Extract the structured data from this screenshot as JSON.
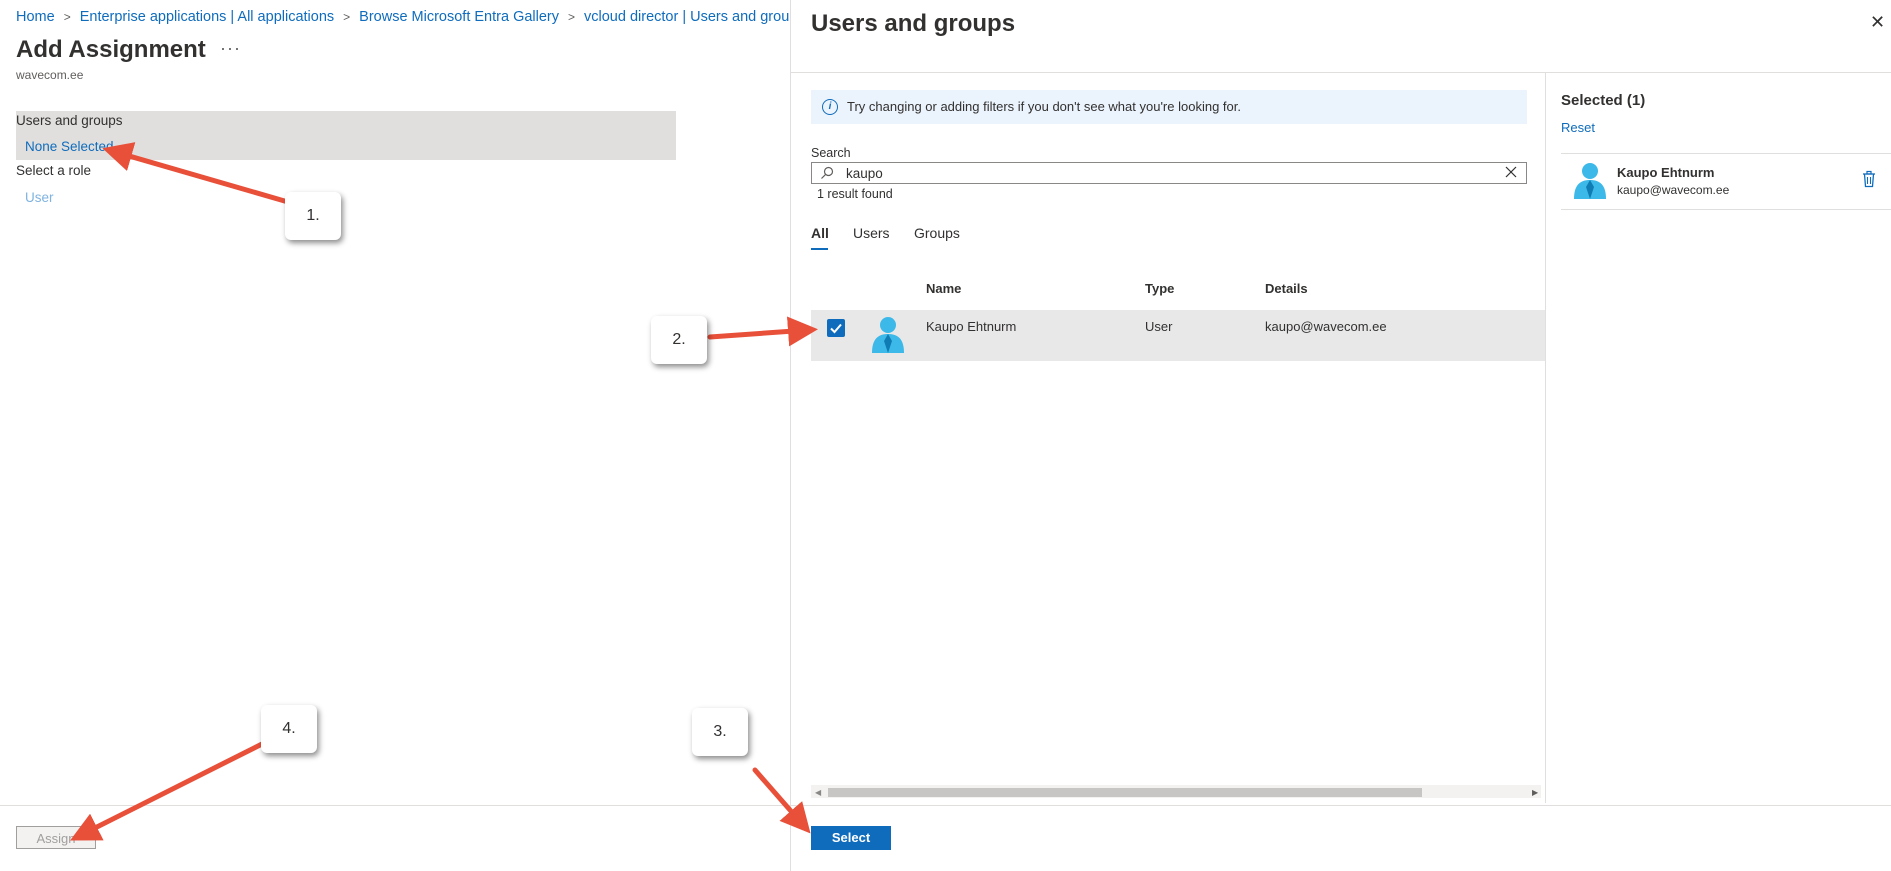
{
  "breadcrumb": [
    {
      "label": "Home"
    },
    {
      "label": "Enterprise applications | All applications"
    },
    {
      "label": "Browse Microsoft Entra Gallery"
    },
    {
      "label": "vcloud director | Users and groups"
    }
  ],
  "left": {
    "title": "Add Assignment",
    "more": "···",
    "subtitle": "wavecom.ee",
    "users_groups_label": "Users and groups",
    "users_groups_value": "None Selected",
    "role_label": "Select a role",
    "role_value": "User",
    "assign_button": "Assign"
  },
  "panel": {
    "title": "Users and groups",
    "close": "✕",
    "info_text": "Try changing or adding filters if you don't see what you're looking for.",
    "search_label": "Search",
    "search_value": "kaupo",
    "result_count": "1 result found",
    "tabs": [
      {
        "label": "All",
        "active": true
      },
      {
        "label": "Users",
        "active": false
      },
      {
        "label": "Groups",
        "active": false
      }
    ],
    "columns": [
      "Name",
      "Type",
      "Details"
    ],
    "rows": [
      {
        "checked": true,
        "name": "Kaupo Ehtnurm",
        "type": "User",
        "details": "kaupo@wavecom.ee"
      }
    ],
    "selected_title": "Selected (1)",
    "reset": "Reset",
    "selected_items": [
      {
        "name": "Kaupo Ehtnurm",
        "email": "kaupo@wavecom.ee"
      }
    ],
    "select_button": "Select"
  },
  "callouts": [
    "1.",
    "2.",
    "3.",
    "4."
  ],
  "colors": {
    "accent": "#0f6cbd",
    "arrow": "#e8503a",
    "row_highlight": "#e8e8e8"
  }
}
